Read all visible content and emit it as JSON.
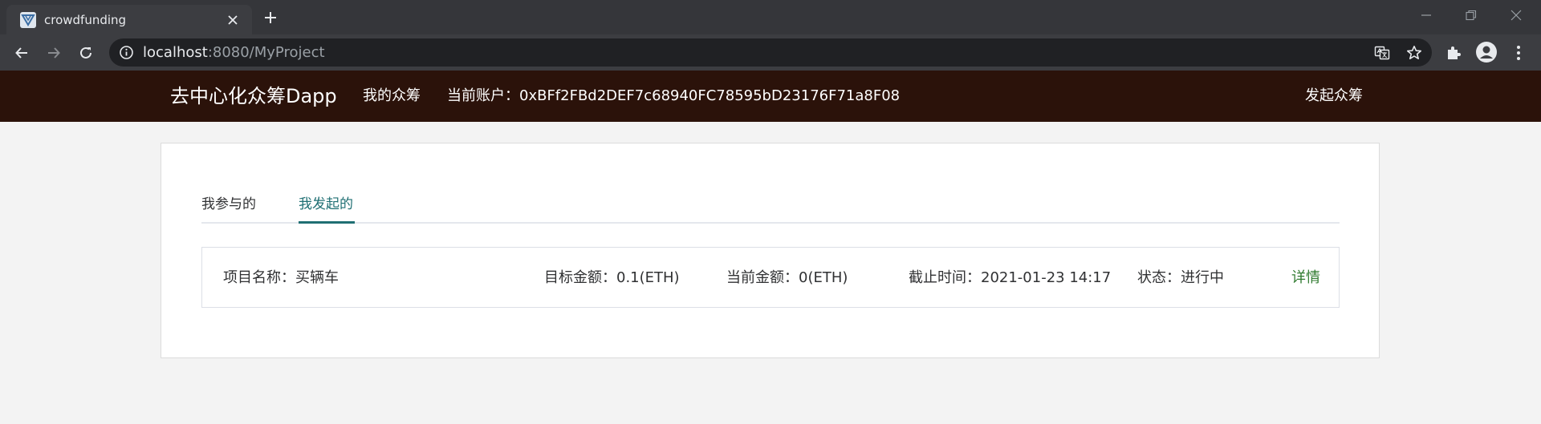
{
  "browser": {
    "tab_title": "crowdfunding",
    "url_host": "localhost",
    "url_rest": ":8080/MyProject"
  },
  "header": {
    "brand": "去中心化众筹Dapp",
    "nav_my_crowdfunding": "我的众筹",
    "account_label": "当前账户：",
    "account_address": "0xBFf2FBd2DEF7c68940FC78595bD23176F71a8F08",
    "start_crowdfunding": "发起众筹"
  },
  "tabs": [
    {
      "label": "我参与的",
      "active": false
    },
    {
      "label": "我发起的",
      "active": true
    }
  ],
  "projects": [
    {
      "name_label": "项目名称：",
      "name": "买辆车",
      "target_label": "目标金额：",
      "target": "0.1(ETH)",
      "current_label": "当前金额：",
      "current": "0(ETH)",
      "deadline_label": "截止时间：",
      "deadline": "2021-01-23 14:17",
      "status_label": "状态：",
      "status": "进行中",
      "detail": "详情"
    }
  ],
  "colors": {
    "header_bg": "#2b120a",
    "accent": "#1f6f73",
    "detail_link": "#2f7a2f"
  }
}
